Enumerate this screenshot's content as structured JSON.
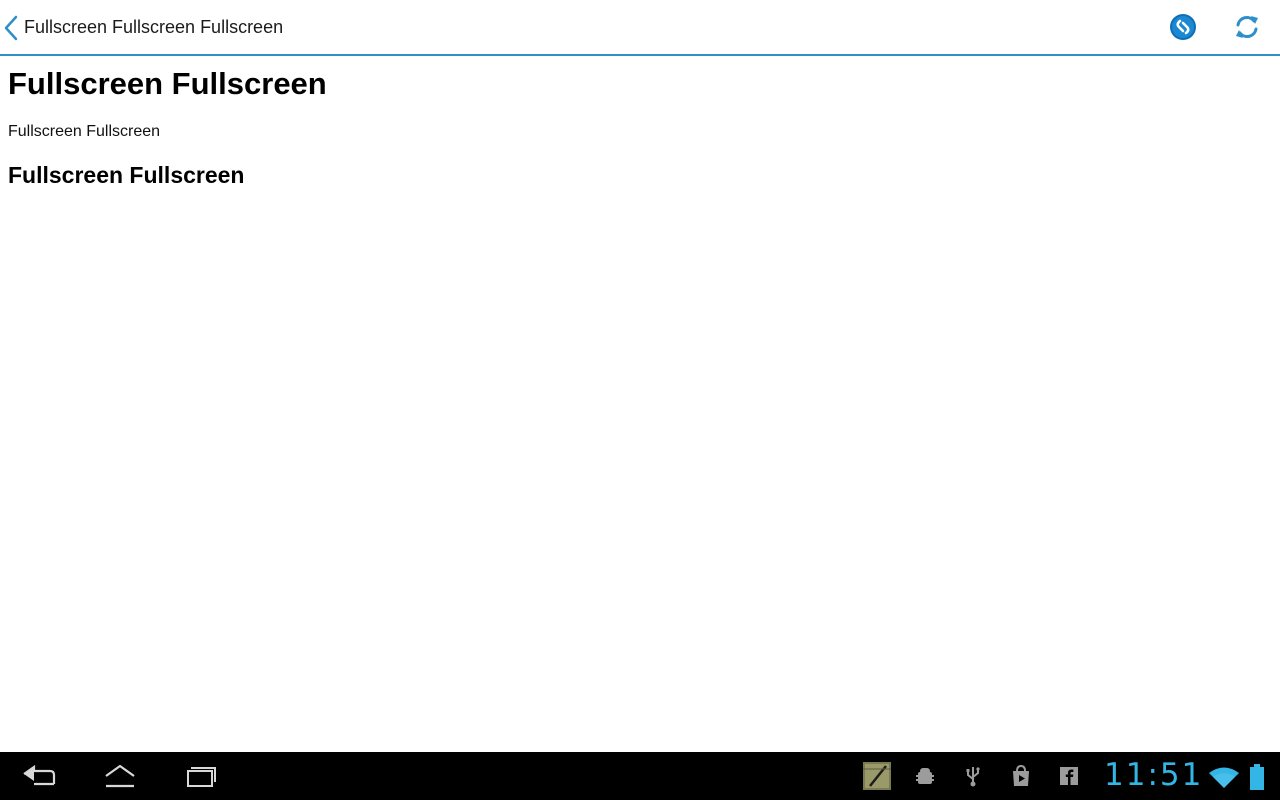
{
  "action_bar": {
    "title": "Fullscreen Fullscreen Fullscreen",
    "icons": {
      "back": "chevron-left-icon",
      "shazam": "shazam-icon",
      "refresh": "refresh-icon"
    },
    "accent_color": "#2f8fc8"
  },
  "content": {
    "heading1": "Fullscreen Fullscreen",
    "paragraph": "Fullscreen Fullscreen",
    "heading2": "Fullscreen Fullscreen"
  },
  "system_bar": {
    "clock": "11:51",
    "clock_color": "#33b5e5",
    "nav_icons": [
      "back-icon",
      "home-icon",
      "recent-apps-icon"
    ],
    "notification_icons": [
      "notes-app-icon",
      "android-debug-icon",
      "usb-icon",
      "play-store-icon",
      "facebook-icon"
    ],
    "status_icons": [
      "wifi-icon",
      "battery-icon"
    ]
  }
}
